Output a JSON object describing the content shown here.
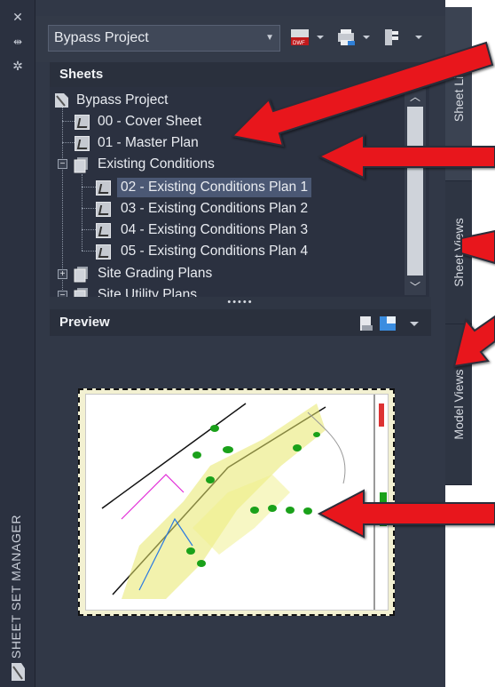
{
  "palette": {
    "titlebar": "#2b3140",
    "panel_bg": "#313847",
    "header_bg": "#2a303d",
    "selection": "#4b5874",
    "text": "#e9ecf1",
    "arrow_red": "#e8161b",
    "arrow_outline": "#2a2f3a"
  },
  "window": {
    "title": "SHEET SET MANAGER",
    "close_icon": "close-icon",
    "autohide_icon": "autohide-icon",
    "properties_icon": "gear-icon"
  },
  "toolbar": {
    "sheet_set_selector": "Bypass Project",
    "icons": [
      "publish-to-dwf-icon",
      "plot-icon",
      "page-setup-icon"
    ]
  },
  "sheets_panel": {
    "title": "Sheets",
    "tree": [
      {
        "label": "Bypass Project",
        "type": "root"
      },
      {
        "label": "00 - Cover Sheet",
        "type": "sheet"
      },
      {
        "label": "01 - Master Plan",
        "type": "sheet"
      },
      {
        "label": "Existing Conditions",
        "type": "subset",
        "expanded": true
      },
      {
        "label": "02 - Existing Conditions Plan 1",
        "type": "sheet",
        "selected": true
      },
      {
        "label": "03 - Existing Conditions Plan 2",
        "type": "sheet"
      },
      {
        "label": "04 - Existing Conditions Plan 3",
        "type": "sheet"
      },
      {
        "label": "05 - Existing Conditions Plan 4",
        "type": "sheet"
      },
      {
        "label": "Site Grading Plans",
        "type": "subset",
        "expanded": false
      },
      {
        "label": "Site Utility Plans",
        "type": "subset",
        "expanded": true
      }
    ]
  },
  "preview_panel": {
    "title": "Preview",
    "icons": [
      "details-view-icon",
      "preview-view-icon",
      "dropdown-icon"
    ]
  },
  "side_tabs": [
    "Sheet List",
    "Sheet Views",
    "Model Views"
  ]
}
